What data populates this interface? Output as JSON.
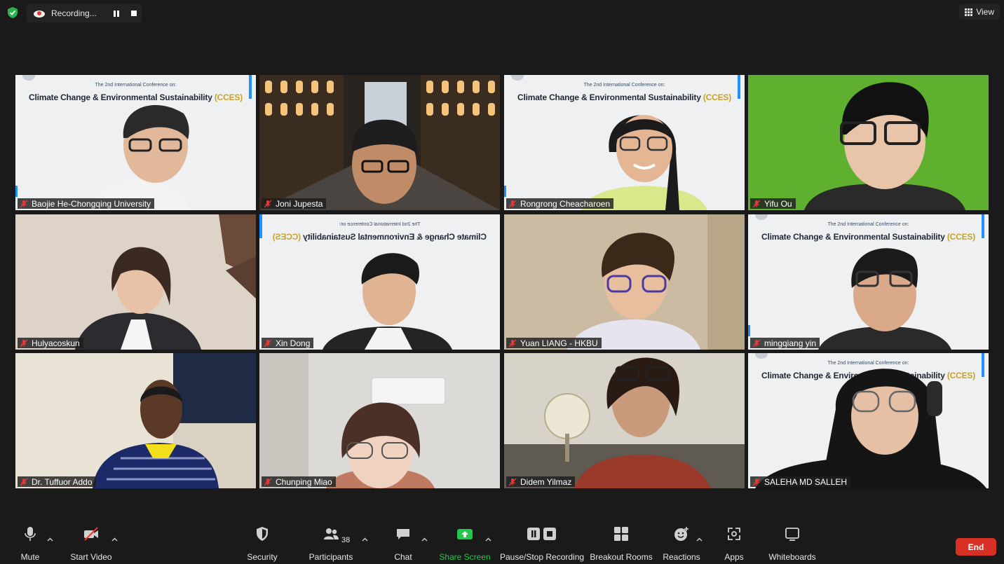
{
  "top": {
    "recording_label": "Recording...",
    "view_label": "View"
  },
  "participants": [
    {
      "name": "Baojie He-Chongqing University",
      "bg": "slide"
    },
    {
      "name": "Joni Jupesta",
      "bg": "street"
    },
    {
      "name": "Rongrong Cheacharoen",
      "bg": "slide"
    },
    {
      "name": "Yifu Ou",
      "bg": "green"
    },
    {
      "name": "Hulyacoskun",
      "bg": "room"
    },
    {
      "name": "Xin Dong",
      "bg": "slide-mirror"
    },
    {
      "name": "Yuan LIANG - HKBU",
      "bg": "room"
    },
    {
      "name": "mingqiang yin",
      "bg": "slide"
    },
    {
      "name": "Dr. Tuffuor Addo",
      "bg": "room"
    },
    {
      "name": "Chunping Miao",
      "bg": "room"
    },
    {
      "name": "Didem Yilmaz",
      "bg": "room"
    },
    {
      "name": "SALEHA MD SALLEH",
      "bg": "slide"
    }
  ],
  "slide": {
    "line1": "The 2nd International Conference on:",
    "line2": "Climate Change & Environmental Sustainability",
    "line2_accent": "(CCES)"
  },
  "toolbar": {
    "mute": "Mute",
    "start_video": "Start Video",
    "security": "Security",
    "participants": "Participants",
    "participants_count": "38",
    "chat": "Chat",
    "share_screen": "Share Screen",
    "pause_stop_recording": "Pause/Stop Recording",
    "breakout_rooms": "Breakout Rooms",
    "reactions": "Reactions",
    "apps": "Apps",
    "whiteboards": "Whiteboards",
    "end": "End"
  },
  "colors": {
    "share_green": "#1fc94a",
    "end_red": "#d93025",
    "active_blue": "#1e90ff",
    "mic_off_red": "#e53935"
  }
}
